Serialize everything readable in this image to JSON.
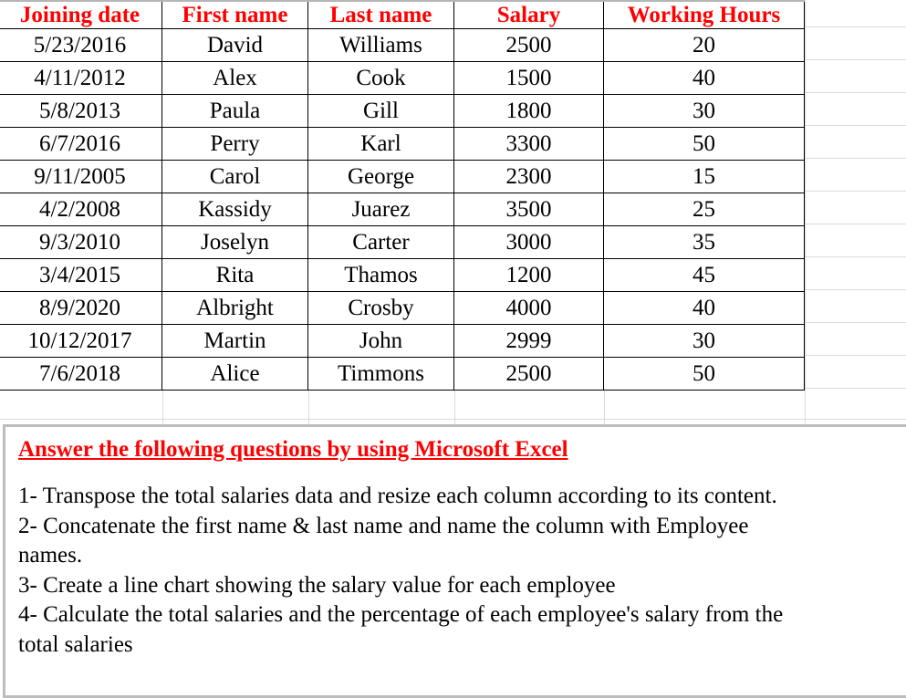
{
  "table": {
    "headers": [
      "Joining date",
      "First name",
      "Last name",
      "Salary",
      "Working Hours"
    ],
    "rows": [
      [
        "5/23/2016",
        "David",
        "Williams",
        "2500",
        "20"
      ],
      [
        "4/11/2012",
        "Alex",
        "Cook",
        "1500",
        "40"
      ],
      [
        "5/8/2013",
        "Paula",
        "Gill",
        "1800",
        "30"
      ],
      [
        "6/7/2016",
        "Perry",
        "Karl",
        "3300",
        "50"
      ],
      [
        "9/11/2005",
        "Carol",
        "George",
        "2300",
        "15"
      ],
      [
        "4/2/2008",
        "Kassidy",
        "Juarez",
        "3500",
        "25"
      ],
      [
        "9/3/2010",
        "Joselyn",
        "Carter",
        "3000",
        "35"
      ],
      [
        "3/4/2015",
        "Rita",
        "Thamos",
        "1200",
        "45"
      ],
      [
        "8/9/2020",
        "Albright",
        "Crosby",
        "4000",
        "40"
      ],
      [
        "10/12/2017",
        "Martin",
        "John",
        "2999",
        "30"
      ],
      [
        "7/6/2018",
        "Alice",
        "Timmons",
        "2500",
        "50"
      ]
    ]
  },
  "textbox": {
    "title": "Answer the following questions by using Microsoft Excel",
    "lines": [
      "1- Transpose the total salaries data and resize each column according to its content.",
      "2- Concatenate the first name & last name and name the column with Employee",
      "names.",
      "3- Create a line chart showing the salary value for each employee",
      "4- Calculate the total salaries and the percentage of each employee's salary from the",
      "total salaries"
    ]
  },
  "colors": {
    "header_text": "#ff0000",
    "title_text": "#ff0000",
    "gridline": "#dadada",
    "textbox_border": "#bdbdbd"
  }
}
